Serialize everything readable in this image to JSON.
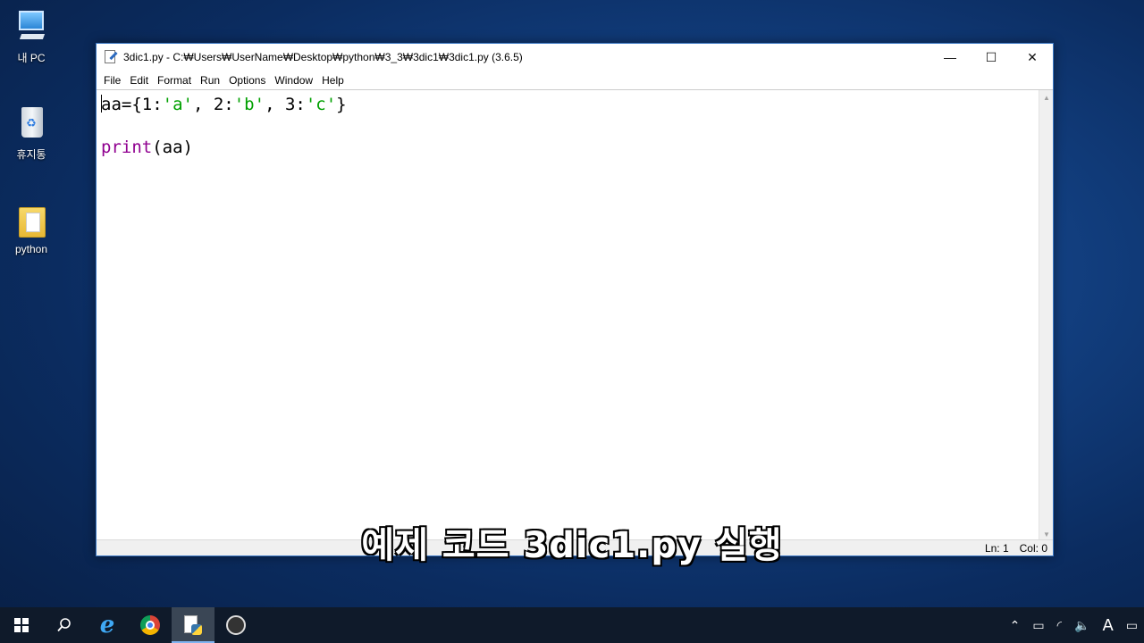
{
  "desktop": {
    "icons": [
      {
        "label": "내 PC"
      },
      {
        "label": "휴지통"
      },
      {
        "label": "python"
      }
    ]
  },
  "window": {
    "title": "3dic1.py - C:₩Users₩UserName₩Desktop₩python₩3_3₩3dic1₩3dic1.py (3.6.5)",
    "controls": {
      "minimize": "—",
      "maximize": "☐",
      "close": "✕"
    },
    "menu": [
      "File",
      "Edit",
      "Format",
      "Run",
      "Options",
      "Window",
      "Help"
    ],
    "code": {
      "line1": {
        "pre": "aa={1:",
        "s1": "'a'",
        "m1": ", 2:",
        "s2": "'b'",
        "m2": ", 3:",
        "s3": "'c'",
        "post": "}"
      },
      "line3": {
        "kw": "print",
        "rest": "(aa)"
      }
    },
    "status": {
      "ln": "Ln: 1",
      "col": "Col: 0"
    }
  },
  "subtitle": "예제 코드 3dic1.py 실행",
  "taskbar": {
    "tray": {
      "chevron": "⌃",
      "ime": "A",
      "notification": "▭"
    }
  }
}
